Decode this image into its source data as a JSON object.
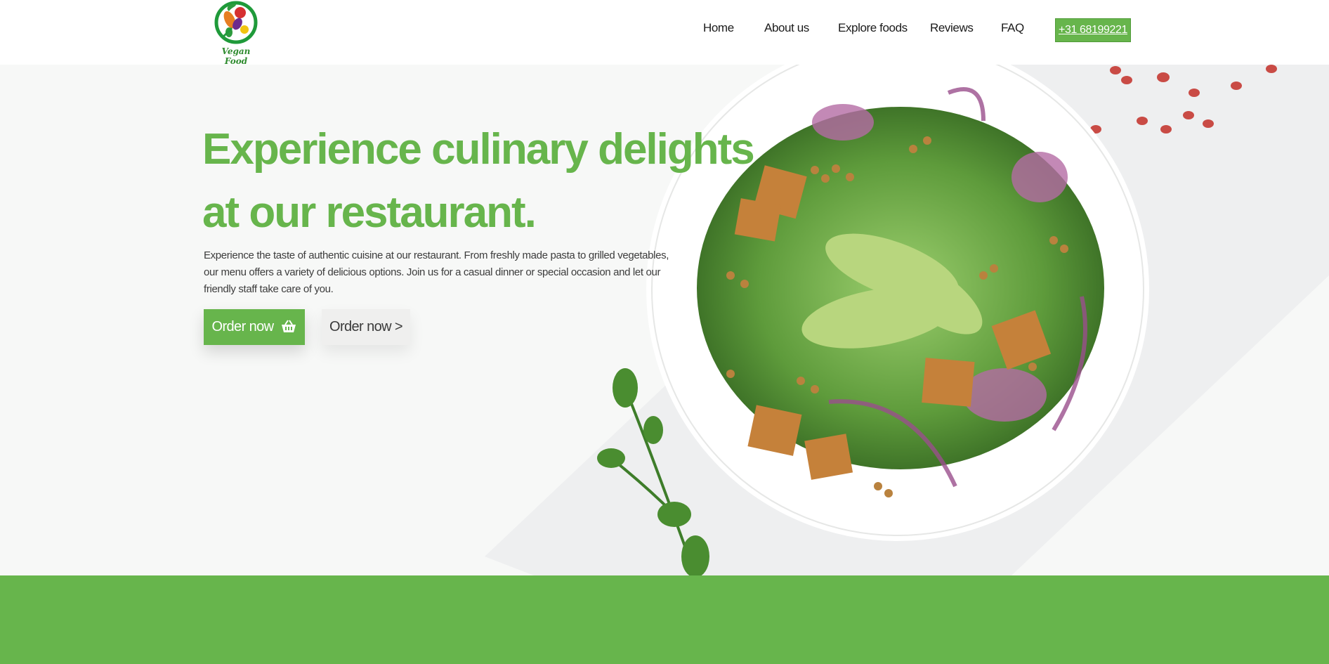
{
  "header": {
    "logo_text": "Vegan Food",
    "nav": [
      {
        "label": "Home"
      },
      {
        "label": "About us"
      },
      {
        "label": "Explore foods"
      },
      {
        "label": "Reviews"
      },
      {
        "label": "FAQ"
      }
    ],
    "phone_label": "+31 68199221"
  },
  "hero": {
    "headline_line1": "Experience culinary delights",
    "headline_line2": "at our restaurant.",
    "intro": "Experience the taste of authentic cuisine at our restaurant. From freshly made pasta to grilled vegetables, our menu offers a variety of delicious options. Join us for a casual dinner or special occasion and let our friendly staff take care of you.",
    "primary_button": "Order now",
    "primary_button_icon": "shopping-basket-icon",
    "secondary_button": "Order now >"
  },
  "colors": {
    "brand_green": "#67b54c",
    "text_dark": "#1b1b1b",
    "hero_bg": "#f7f8f7"
  }
}
